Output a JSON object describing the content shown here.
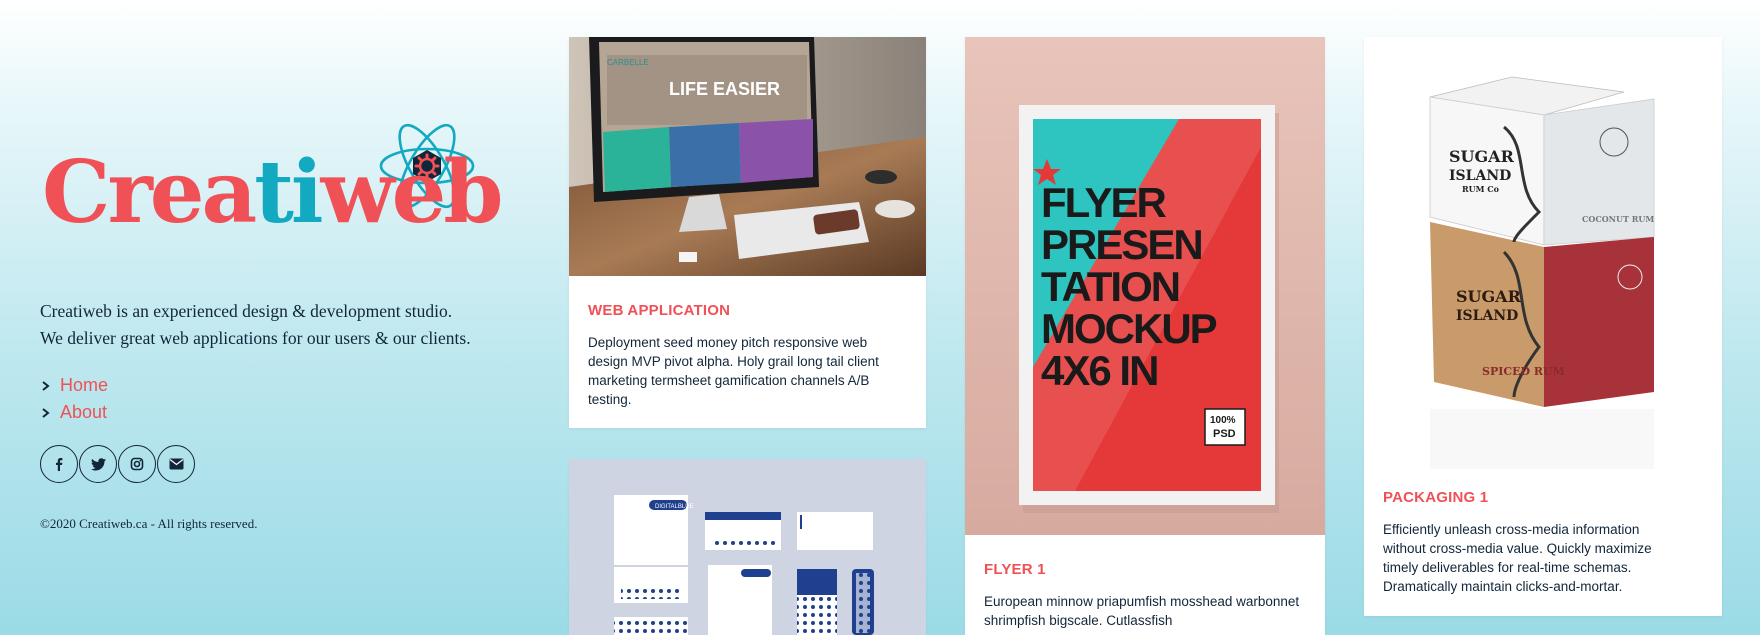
{
  "brand": {
    "logo_part1": "Crea",
    "logo_part2": "ti",
    "logo_part3": "web",
    "red": "#f05156",
    "teal": "#13a9c1",
    "navy": "#12263a"
  },
  "intro": {
    "line1": "Creatiweb is an experienced design & development studio.",
    "line2": "We deliver great web applications for our users & our clients."
  },
  "nav": {
    "items": [
      {
        "label": "Home",
        "icon": "chevron-right-icon"
      },
      {
        "label": "About",
        "icon": "chevron-right-icon"
      }
    ]
  },
  "social": [
    "facebook-icon",
    "twitter-icon",
    "instagram-icon",
    "envelope-icon"
  ],
  "footer": {
    "copyright": "©2020 Creatiweb.ca - All rights reserved."
  },
  "cards": [
    {
      "title": "WEB APPLICATION",
      "desc": "Deployment seed money pitch responsive web design MVP pivot alpha. Holy grail long tail client marketing termsheet gamification channels A/B testing.",
      "screen_logo": "CARBELLE",
      "screen_text": "LIFE EASIER"
    },
    {
      "title": "",
      "desc": "",
      "brand_text": "DIGITALBLUE"
    },
    {
      "title": "FLYER 1",
      "desc": "European minnow priapumfish mosshead warbonnet shrimpfish bigscale. Cutlassfish",
      "poster_lines": [
        "FLYER",
        "PRESEN",
        "TATION",
        "MOCKUP",
        "4X6 IN"
      ],
      "badge_line1": "100%",
      "badge_line2": "PSD"
    },
    {
      "title": "PACKAGING 1",
      "desc": "Efficiently unleash cross-media information without cross-media value. Quickly maximize timely deliverables for real-time schemas. Dramatically maintain clicks-and-mortar.",
      "box_brand1": "SUGAR",
      "box_brand2": "ISLAND",
      "box_brand3": "RUM Co",
      "box_label_top": "COCONUT RUM",
      "box_label_bottom": "SPICED RUM"
    }
  ]
}
